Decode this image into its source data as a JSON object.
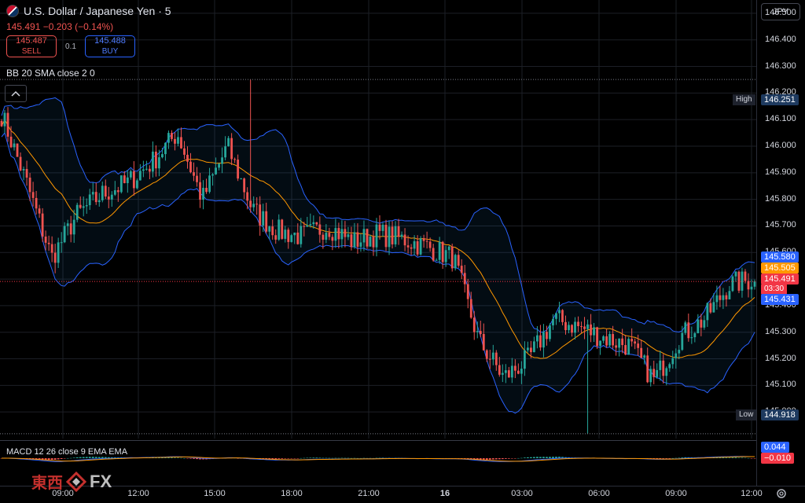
{
  "symbol": {
    "title": "U.S. Dollar / Japanese Yen · 5",
    "last": "145.491",
    "change": "−0.203",
    "change_pct": "(−0.14%)",
    "flag_icon": "us-jp-flag-icon"
  },
  "trade": {
    "sell_price": "145.487",
    "sell_label": "SELL",
    "spread": "0.1",
    "buy_price": "145.488",
    "buy_label": "BUY"
  },
  "indicator": {
    "label": "BB 20 SMA close 2 0"
  },
  "collapse_icon": "chevron-up-icon",
  "currency_button": "JPY",
  "price_axis": {
    "ticks": [
      "146.500",
      "146.400",
      "146.300",
      "146.200",
      "146.100",
      "146.000",
      "145.900",
      "145.800",
      "145.700",
      "145.600",
      "145.500",
      "145.400",
      "145.300",
      "145.200",
      "145.100",
      "145.000"
    ],
    "tags": {
      "bb_upper": "145.580",
      "bb_basis": "145.505",
      "last_price": "145.491",
      "countdown": "03:30",
      "bb_lower": "145.431"
    },
    "high_label": "High",
    "high_value": "146.251",
    "low_label": "Low",
    "low_value": "144.918"
  },
  "macd": {
    "label": "MACD 12 26 close 9 EMA EMA",
    "value_macd": "0.044",
    "value_signal": "−0.010"
  },
  "time_axis": [
    "09:00",
    "12:00",
    "15:00",
    "18:00",
    "21:00",
    "16",
    "03:00",
    "06:00",
    "09:00",
    "12:00"
  ],
  "colors": {
    "up": "#26a69a",
    "down": "#ef5350",
    "bb_band": "#2962ff",
    "bb_basis": "#ff9800",
    "last_price_bg": "#f23645",
    "background": "#000000"
  },
  "watermark": {
    "cn": "東西",
    "fx": "FX"
  },
  "settings_icon": "gear-icon",
  "chart_data": {
    "type": "candlestick",
    "ylim": [
      144.9,
      146.55
    ],
    "timeframe_minutes": 5,
    "x_ticks": [
      "09:00",
      "12:00",
      "15:00",
      "18:00",
      "21:00",
      "16",
      "03:00",
      "06:00",
      "09:00",
      "12:00"
    ],
    "high": 146.251,
    "low": 144.918,
    "last": 145.491,
    "close_waypoints": [
      146.12,
      145.86,
      145.58,
      145.74,
      145.82,
      145.86,
      145.94,
      146.05,
      145.8,
      146.0,
      145.76,
      145.68,
      145.66,
      145.7,
      145.64,
      145.67,
      145.65,
      145.62,
      145.58,
      145.27,
      145.13,
      145.2,
      145.35,
      145.32,
      145.28,
      145.25,
      145.12,
      145.28,
      145.35,
      145.48,
      145.5
    ],
    "series": [
      {
        "name": "BB 20 SMA close 2 0",
        "indicator": "bollinger",
        "period": 20,
        "stddev": 2
      },
      {
        "name": "MACD 12 26 close 9 EMA EMA",
        "indicator": "macd",
        "macd": 0.044,
        "signal": -0.01
      }
    ]
  }
}
